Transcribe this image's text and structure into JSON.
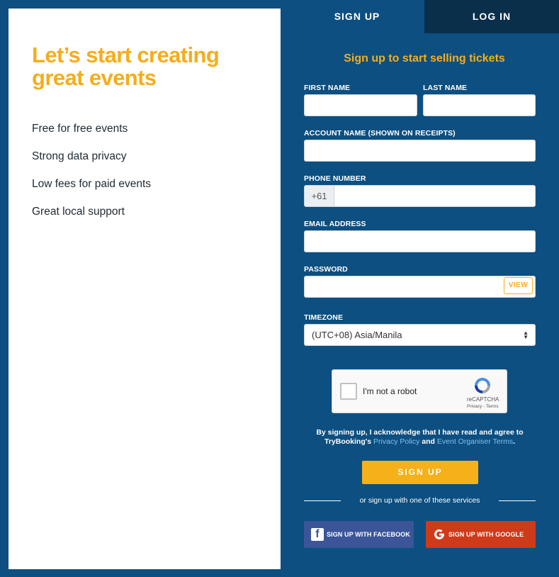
{
  "left": {
    "headline": "Let’s start creating great events",
    "features": [
      "Free for free events",
      "Strong data privacy",
      "Low fees for paid events",
      "Great local support"
    ]
  },
  "tabs": {
    "signup": "SIGN UP",
    "login": "LOG IN"
  },
  "form": {
    "title": "Sign up to start selling tickets",
    "first_name_label": "FIRST NAME",
    "last_name_label": "LAST NAME",
    "account_name_label": "ACCOUNT NAME (SHOWN ON RECEIPTS)",
    "phone_label": "PHONE NUMBER",
    "phone_prefix": "+61",
    "email_label": "EMAIL ADDRESS",
    "password_label": "PASSWORD",
    "view_label": "VIEW",
    "timezone_label": "TIMEZONE",
    "timezone_value": "(UTC+08) Asia/Manila"
  },
  "captcha": {
    "label": "I'm not a robot",
    "brand": "reCAPTCHA",
    "terms": "Privacy - Terms"
  },
  "legal": {
    "prefix": "By signing up, I acknowledge that I have read and agree to TryBooking's ",
    "privacy_link": "Privacy Policy",
    "and": " and ",
    "terms_link": "Event Organiser Terms",
    "suffix": "."
  },
  "actions": {
    "signup_button": "SIGN UP",
    "divider_text": "or sign up with one of these services",
    "facebook_button": "SIGN UP WITH FACEBOOK",
    "google_button": "SIGN UP WITH GOOGLE"
  },
  "icons": {
    "facebook": "facebook-icon",
    "google": "google-icon",
    "recaptcha": "recaptcha-icon",
    "select_arrow": "select-arrows-icon"
  },
  "colors": {
    "background": "#0d4f80",
    "accent": "#f5ad1c",
    "tab_inactive": "#0a2f4b",
    "facebook": "#3b5598",
    "google": "#cf3a1a",
    "link": "#7ec3ef"
  }
}
